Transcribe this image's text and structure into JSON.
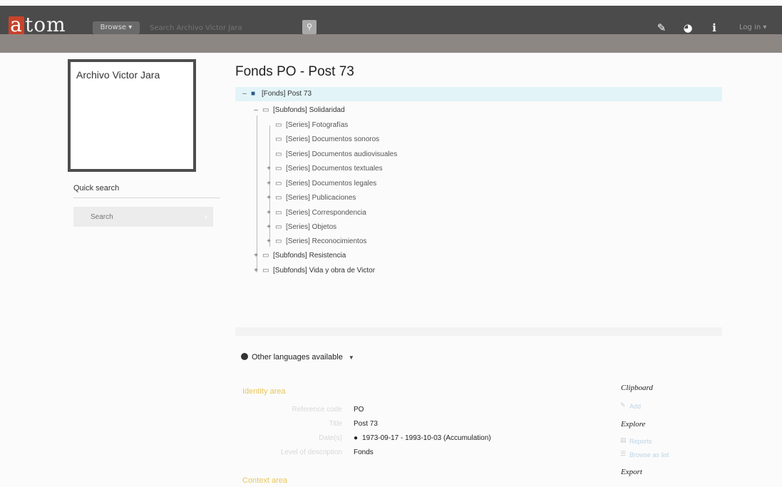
{
  "header": {
    "logo": "tom",
    "logo_letter": "a",
    "browse_label": "Browse",
    "search_placeholder": "Search Archivo Victor Jara",
    "login_label": "Log in"
  },
  "sidebar": {
    "repository_name": "Archivo Victor Jara",
    "quick_search_label": "Quick search",
    "quick_search_placeholder": "Search"
  },
  "main": {
    "title": "Fonds PO - Post 73",
    "tree": [
      {
        "label": "[Fonds] Post 73",
        "toggle": "–"
      },
      {
        "label": "[Subfonds] Solidaridad",
        "toggle": "–"
      },
      {
        "label": "[Series] Fotografías",
        "toggle": ""
      },
      {
        "label": "[Series] Documentos sonoros",
        "toggle": ""
      },
      {
        "label": "[Series] Documentos audiovisuales",
        "toggle": ""
      },
      {
        "label": "[Series] Documentos textuales",
        "toggle": "+"
      },
      {
        "label": "[Series] Documentos legales",
        "toggle": "+"
      },
      {
        "label": "[Series] Publicaciones",
        "toggle": "+"
      },
      {
        "label": "[Series] Correspondencia",
        "toggle": "+"
      },
      {
        "label": "[Series] Objetos",
        "toggle": "+"
      },
      {
        "label": "[Series] Reconocimientos",
        "toggle": "+"
      },
      {
        "label": "[Subfonds] Resistencia",
        "toggle": "+"
      },
      {
        "label": "[Subfonds] Vida y obra de Victor",
        "toggle": "+"
      }
    ],
    "other_languages": "Other languages available",
    "identity_area_title": "Identity area",
    "fields": [
      {
        "label": "Reference code",
        "value": "PO"
      },
      {
        "label": "Title",
        "value": "Post 73"
      },
      {
        "label": "Date(s)",
        "value": "1973-09-17 - 1993-10-03 (Accumulation)"
      },
      {
        "label": "Level of description",
        "value": "Fonds"
      }
    ],
    "context_area_title": "Context area"
  },
  "right_panel": {
    "clipboard_heading": "Clipboard",
    "clipboard_add": "Add",
    "explore_heading": "Explore",
    "explore_reports": "Reports",
    "explore_browse": "Browse as list",
    "export_heading": "Export"
  }
}
